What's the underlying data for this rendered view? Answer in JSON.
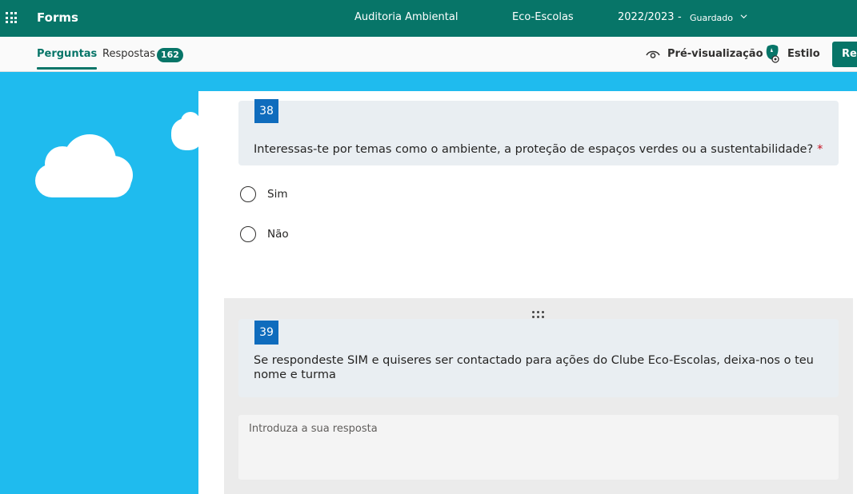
{
  "topbar": {
    "app_name": "Forms",
    "form_title": "Auditoria Ambiental",
    "group_name": "Eco-Escolas",
    "year": "2022/2023",
    "separator": "-",
    "save_status": "Guardado"
  },
  "toolbar": {
    "tab_questions": "Perguntas",
    "tab_responses": "Respostas",
    "responses_count": "162",
    "preview_label": "Pré-visualização",
    "style_label": "Estilo",
    "record_button_label": "Rec"
  },
  "questions": [
    {
      "number": "38",
      "text": "Interessas-te por temas como o ambiente, a proteção de espaços verdes ou a sustentabilidade?",
      "required_mark": "*",
      "options": [
        "Sim",
        "Não"
      ]
    },
    {
      "number": "39",
      "text": "Se respondeste SIM e quiseres ser contactado para ações do Clube Eco-Escolas, deixa-nos o teu nome e turma",
      "answer_placeholder": "Introduza a sua resposta"
    }
  ],
  "colors": {
    "accent": "#077568",
    "background": "#1fbbee",
    "question_number": "#0f6cbd",
    "required": "#c50f1f"
  }
}
